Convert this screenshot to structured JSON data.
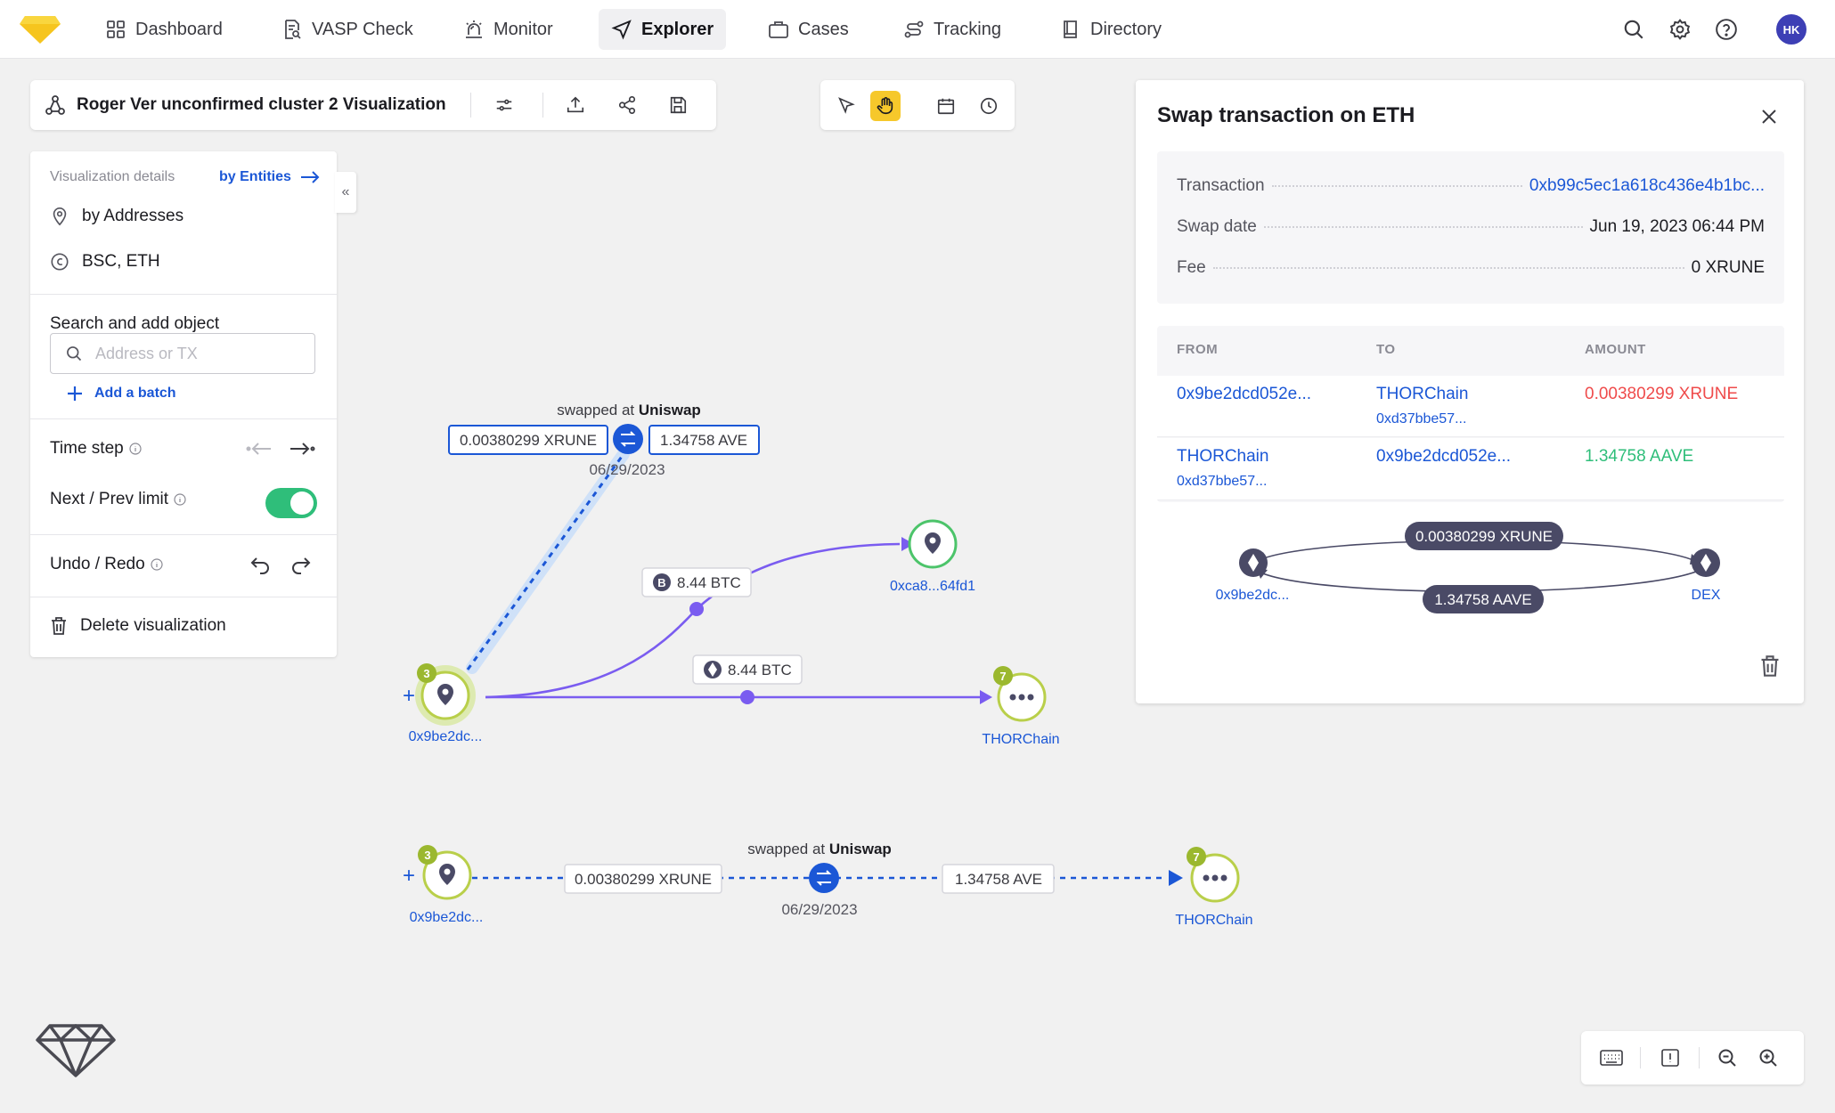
{
  "topnav": {
    "items": [
      {
        "label": "Dashboard",
        "icon": "grid-icon"
      },
      {
        "label": "VASP Check",
        "icon": "document-search-icon"
      },
      {
        "label": "Monitor",
        "icon": "siren-icon"
      },
      {
        "label": "Explorer",
        "icon": "navigation-icon",
        "active": true
      },
      {
        "label": "Cases",
        "icon": "briefcase-icon"
      },
      {
        "label": "Tracking",
        "icon": "route-icon"
      },
      {
        "label": "Directory",
        "icon": "book-icon"
      }
    ],
    "avatar": "HK"
  },
  "titlebar": {
    "title": "Roger Ver unconfirmed cluster 2 Visualization"
  },
  "left_panel": {
    "details_label": "Visualization details",
    "by_entities": "by Entities",
    "by_addresses": "by Addresses",
    "chains": "BSC, ETH",
    "search_heading": "Search and add object",
    "search_placeholder": "Address or TX",
    "add_batch": "Add a batch",
    "time_step": "Time step",
    "next_prev_limit": "Next / Prev limit",
    "next_prev_enabled": true,
    "undo_redo": "Undo / Redo",
    "delete_visualization": "Delete visualization"
  },
  "graph": {
    "swap_top": {
      "label_prefix": "swapped at",
      "dex": "Uniswap",
      "from_amount": "0.00380299 XRUNE",
      "to_amount": "1.34758 AVE",
      "date": "06/29/2023"
    },
    "edge_btc": "8.44 BTC",
    "edge_eth": "8.44 BTC",
    "node_source": {
      "label": "0x9be2dc...",
      "badge": "3"
    },
    "node_mid": {
      "label": "0xca8...64fd1"
    },
    "node_thor": {
      "label": "THORChain",
      "badge": "7"
    },
    "bottom_row": {
      "source_label": "0x9be2dc...",
      "source_badge": "3",
      "from_amount": "0.00380299 XRUNE",
      "label_prefix": "swapped at",
      "dex": "Uniswap",
      "date": "06/29/2023",
      "to_amount": "1.34758 AVE",
      "target_label": "THORChain",
      "target_badge": "7"
    },
    "colors": {
      "purple": "#7a5cf0",
      "blue": "#1b57d6",
      "green_ring": "#b9cf4a",
      "node_dark": "#4a4a66"
    }
  },
  "right_panel": {
    "title": "Swap transaction on ETH",
    "transaction_label": "Transaction",
    "transaction_value": "0xb99c5ec1a618c436e4b1bc...",
    "swap_date_label": "Swap date",
    "swap_date_value": "Jun 19, 2023 06:44 PM",
    "fee_label": "Fee",
    "fee_value": "0 XRUNE",
    "table": {
      "headers": [
        "FROM",
        "TO",
        "AMOUNT"
      ],
      "rows": [
        {
          "from": "0x9be2dcd052e...",
          "from_sub": "",
          "to": "THORChain",
          "to_sub": "0xd37bbe57...",
          "amount": "0.00380299 XRUNE",
          "amount_color": "red"
        },
        {
          "from": "THORChain",
          "from_sub": "0xd37bbe57...",
          "to": "0x9be2dcd052e...",
          "to_sub": "",
          "amount": "1.34758 AAVE",
          "amount_color": "green"
        }
      ]
    },
    "mini_graph": {
      "left_label": "0x9be2dc...",
      "right_label": "DEX",
      "top_amount": "0.00380299 XRUNE",
      "bottom_amount": "1.34758 AAVE"
    }
  }
}
